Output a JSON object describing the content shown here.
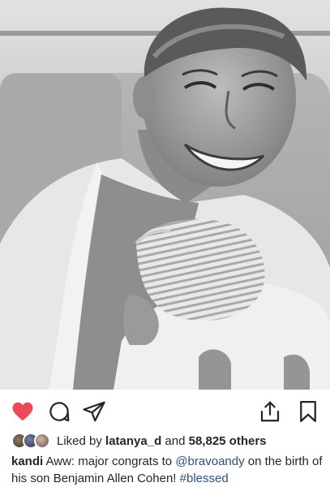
{
  "photo": {
    "alt_subject": "post-photo"
  },
  "actions": {
    "like_color": "#ed4956",
    "icons": [
      "heart-icon",
      "comment-icon",
      "share-icon",
      "upload-icon",
      "bookmark-icon"
    ]
  },
  "likes": {
    "prefix": "Liked by",
    "user": "latanya_d",
    "conjunction": "and",
    "others": "58,825 others"
  },
  "caption": {
    "username": "kandi",
    "text_before": "Aww: major congrats to",
    "mention": "@bravoandy",
    "text_middle": "on the birth of his son Benjamin Allen Cohen!",
    "hashtag": "#blessed"
  }
}
